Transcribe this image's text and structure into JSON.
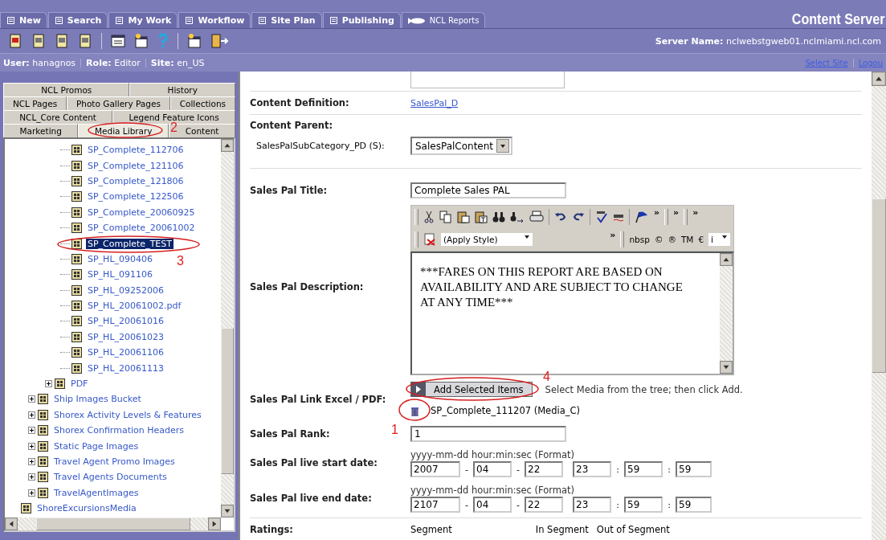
{
  "nav": {
    "tabs": [
      {
        "label": "New",
        "kind": "main"
      },
      {
        "label": "Search",
        "kind": "main"
      },
      {
        "label": "My Work",
        "kind": "main"
      },
      {
        "label": "Workflow",
        "kind": "main"
      },
      {
        "label": "Site Plan",
        "kind": "main"
      },
      {
        "label": "Publishing",
        "kind": "main"
      },
      {
        "label": "NCL Reports",
        "kind": "report"
      }
    ],
    "brand": "Content Server",
    "server": {
      "label": "Server Name:",
      "value": "nclwebstgweb01.nclmiami.ncl.com"
    }
  },
  "user_bar": {
    "fields": [
      {
        "label": "User:",
        "value": "hanagnos"
      },
      {
        "label": "Role:",
        "value": "Editor"
      },
      {
        "label": "Site:",
        "value": "en_US"
      }
    ],
    "links": [
      "Select Site",
      "Logou"
    ]
  },
  "sidebar": {
    "tab_rows": [
      [
        {
          "label": "NCL Promos",
          "selected": false
        },
        {
          "label": "History",
          "selected": false
        }
      ],
      [
        {
          "label": "NCL Pages",
          "selected": false
        },
        {
          "label": "Photo Gallery Pages",
          "selected": false
        },
        {
          "label": "Collections",
          "selected": false
        }
      ],
      [
        {
          "label": "NCL_Core Content",
          "selected": false
        },
        {
          "label": "Legend Feature Icons",
          "selected": false
        }
      ],
      [
        {
          "label": "Marketing",
          "selected": false
        },
        {
          "label": "Media Library",
          "selected": true
        },
        {
          "label": "Content",
          "selected": false
        }
      ]
    ],
    "tree": [
      {
        "children": [
          {
            "children": [
              {
                "children": [
                  {
                    "label": "SP_Complete_112706",
                    "selected": false
                  },
                  {
                    "label": "SP_Complete_121106",
                    "selected": false
                  },
                  {
                    "label": "SP_Complete_121806",
                    "selected": false
                  },
                  {
                    "label": "SP_Complete_122506",
                    "selected": false
                  },
                  {
                    "label": "SP_Complete_20060925",
                    "selected": false
                  },
                  {
                    "label": "SP_Complete_20061002",
                    "selected": false
                  },
                  {
                    "label": "SP_Complete_TEST",
                    "selected": true
                  },
                  {
                    "label": "SP_HL_090406",
                    "selected": false
                  },
                  {
                    "label": "SP_HL_091106",
                    "selected": false
                  },
                  {
                    "label": "SP_HL_09252006",
                    "selected": false
                  },
                  {
                    "label": "SP_HL_20061002.pdf",
                    "selected": false
                  },
                  {
                    "label": "SP_HL_20061016",
                    "selected": false
                  },
                  {
                    "label": "SP_HL_20061023",
                    "selected": false
                  },
                  {
                    "label": "SP_HL_20061106",
                    "selected": false
                  },
                  {
                    "label": "SP_HL_20061113",
                    "selected": false
                  }
                ]
              },
              {
                "label": "PDF",
                "selected": false,
                "expanded": false
              }
            ]
          },
          {
            "label": "Ship Images Bucket",
            "selected": false,
            "expanded": false
          },
          {
            "label": "Shorex Activity Levels & Features",
            "selected": false,
            "expanded": false
          },
          {
            "label": "Shorex Confirmation Headers",
            "selected": false,
            "expanded": false
          },
          {
            "label": "Static Page Images",
            "selected": false,
            "expanded": false
          },
          {
            "label": "Travel Agent Promo Images",
            "selected": false,
            "expanded": false
          },
          {
            "label": "Travel Agents Documents",
            "selected": false,
            "expanded": false
          },
          {
            "label": "TravelAgentImages",
            "selected": false,
            "expanded": false
          }
        ]
      },
      {
        "label": "ShoreExcursionsMedia",
        "selected": false
      }
    ]
  },
  "form": {
    "content_definition": {
      "label": "Content Definition:",
      "link": "SalesPal_D"
    },
    "content_parent": {
      "label": "Content Parent:",
      "sub_label": "SalesPalSubCategory_PD (S):",
      "value": "SalesPalContent"
    },
    "title": {
      "label": "Sales Pal Title:",
      "value": "Complete Sales PAL"
    },
    "description": {
      "label": "Sales Pal Description:",
      "style": "(Apply Style)",
      "chevrons": [
        "»",
        "»",
        "»",
        "»"
      ],
      "symbols": [
        "nbsp",
        "©",
        "®",
        "TM",
        "€"
      ],
      "font_select": "i",
      "value": "***FARES ON THIS REPORT ARE BASED ON AVAILABILITY AND ARE SUBJECT TO CHANGE AT ANY TIME***"
    },
    "link": {
      "label": "Sales Pal Link Excel / PDF:",
      "button": "Add Selected Items",
      "hint": "Select Media from the tree; then click Add.",
      "attachment": "SP_Complete_111207 (Media_C)"
    },
    "rank": {
      "label": "Sales Pal Rank:",
      "value": "1"
    },
    "date_separators": [
      "-",
      "-",
      ":",
      ":"
    ],
    "dates": [
      {
        "label": "Sales Pal live start date:",
        "format": "yyyy-mm-dd hour:min:sec (Format)",
        "parts": [
          "2007",
          "04",
          "22",
          "23",
          "59",
          "59"
        ]
      },
      {
        "label": "Sales Pal live end date:",
        "format": "yyyy-mm-dd hour:min:sec (Format)",
        "parts": [
          "2107",
          "04",
          "22",
          "23",
          "59",
          "59"
        ]
      }
    ],
    "ratings": {
      "label": "Ratings:",
      "columns": [
        "Segment",
        "In Segment",
        "Out of Segment"
      ]
    }
  },
  "annotations": [
    {
      "label": "2",
      "kind": "tab"
    },
    {
      "label": "3",
      "kind": "tree"
    },
    {
      "label": "4",
      "kind": "button"
    },
    {
      "label": "1",
      "kind": "attachment"
    }
  ]
}
